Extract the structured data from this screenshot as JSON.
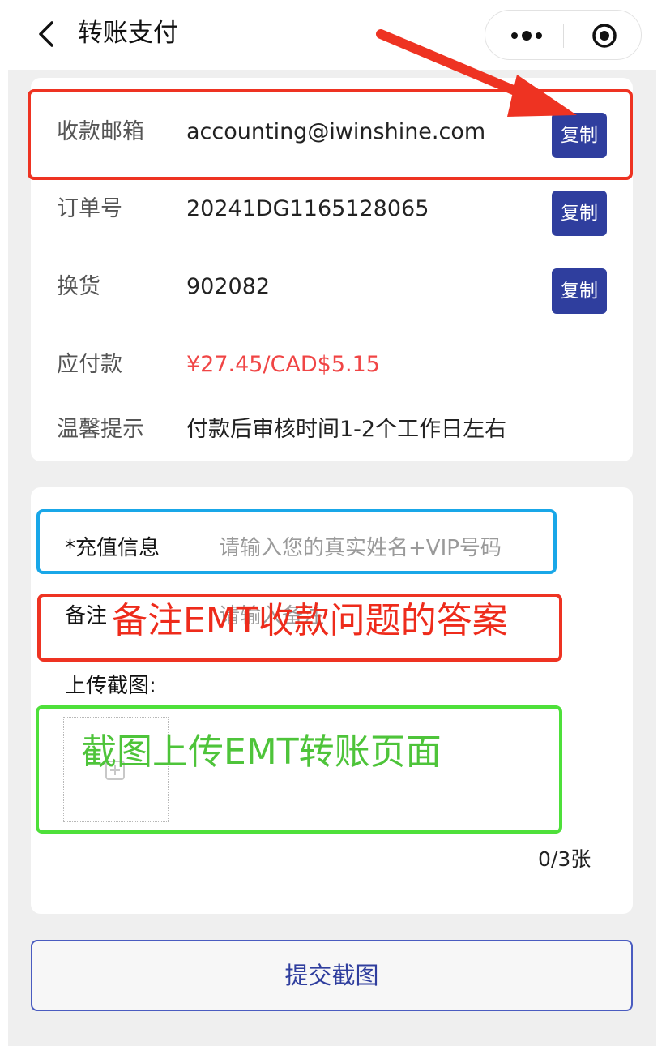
{
  "header": {
    "title": "转账支付",
    "back_icon": "chevron-left-icon",
    "more_icon": "more-dots-icon",
    "target_icon": "target-icon"
  },
  "info": {
    "rows": [
      {
        "label": "收款邮箱",
        "value": "accounting@iwinshine.com",
        "copy": "复制"
      },
      {
        "label": "订单号",
        "value": "20241DG1165128065",
        "copy": "复制"
      },
      {
        "label": "换货",
        "value": "902082",
        "copy": "复制"
      },
      {
        "label": "应付款",
        "value": "¥27.45/CAD$5.15"
      },
      {
        "label": "温馨提示",
        "value": "付款后审核时间1-2个工作日左右"
      }
    ]
  },
  "form": {
    "recharge_label": "*充值信息",
    "recharge_placeholder": "请输入您的真实姓名+VIP号码",
    "note_label": "备注",
    "note_placeholder": "请输入备注",
    "upload_label": "上传截图:",
    "upload_count": "0/3张"
  },
  "annotations": {
    "note_hint": "备注EMT收款问题的答案",
    "upload_hint": "截图上传EMT转账页面"
  },
  "submit": {
    "label": "提交截图"
  },
  "colors": {
    "primary": "#2f3e9e",
    "price_red": "#f04545",
    "highlight_red": "#ee3322",
    "highlight_blue": "#19a7e8",
    "highlight_green": "#4ee03a"
  }
}
